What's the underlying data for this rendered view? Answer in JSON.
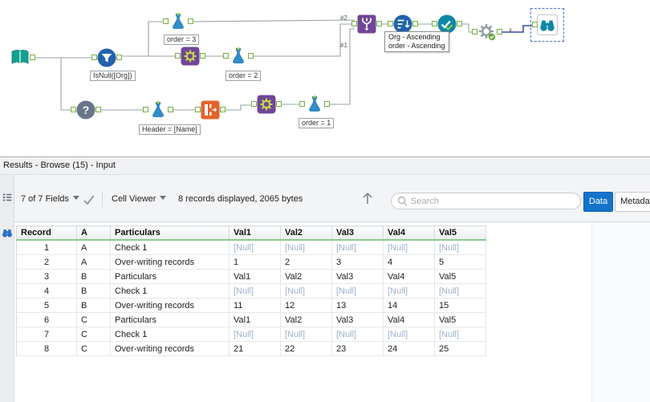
{
  "canvas": {
    "tool_labels": {
      "isnull": "IsNull([Org])",
      "order3": "order = 3",
      "order2": "order = 2",
      "order1": "order = 1",
      "header_name": "Header = [Name]"
    },
    "wire_annotations": {
      "top": "#2",
      "mid": "#1",
      "x_mark": "x"
    },
    "sort_tooltip": {
      "line1": "Org - Ascending",
      "line2": "order - Ascending"
    }
  },
  "results": {
    "title": "Results - Browse (15) - Input",
    "toolbar": {
      "fields_selector": "7 of 7 Fields",
      "cell_viewer": "Cell Viewer",
      "records_info": "8 records displayed, 2065 bytes",
      "search_placeholder": "Search",
      "data_tab": "Data",
      "metadata_tab": "Metadata"
    },
    "table": {
      "columns": [
        "Record",
        "A",
        "Particulars",
        "Val1",
        "Val2",
        "Val3",
        "Val4",
        "Val5"
      ],
      "rows": [
        [
          "1",
          "A",
          "Check 1",
          "[Null]",
          "[Null]",
          "[Null]",
          "[Null]",
          "[Null]"
        ],
        [
          "2",
          "A",
          "Over-writing records",
          "1",
          "2",
          "3",
          "4",
          "5"
        ],
        [
          "3",
          "B",
          "Particulars",
          "Val1",
          "Val2",
          "Val3",
          "Val4",
          "Val5"
        ],
        [
          "4",
          "B",
          "Check 1",
          "[Null]",
          "[Null]",
          "[Null]",
          "[Null]",
          "[Null]"
        ],
        [
          "5",
          "B",
          "Over-writing records",
          "11",
          "12",
          "13",
          "14",
          "15"
        ],
        [
          "6",
          "C",
          "Particulars",
          "Val1",
          "Val2",
          "Val3",
          "Val4",
          "Val5"
        ],
        [
          "7",
          "C",
          "Check 1",
          "[Null]",
          "[Null]",
          "[Null]",
          "[Null]",
          "[Null]"
        ],
        [
          "8",
          "C",
          "Over-writing records",
          "21",
          "22",
          "23",
          "24",
          "25"
        ]
      ],
      "null_display": "[Null]"
    }
  }
}
